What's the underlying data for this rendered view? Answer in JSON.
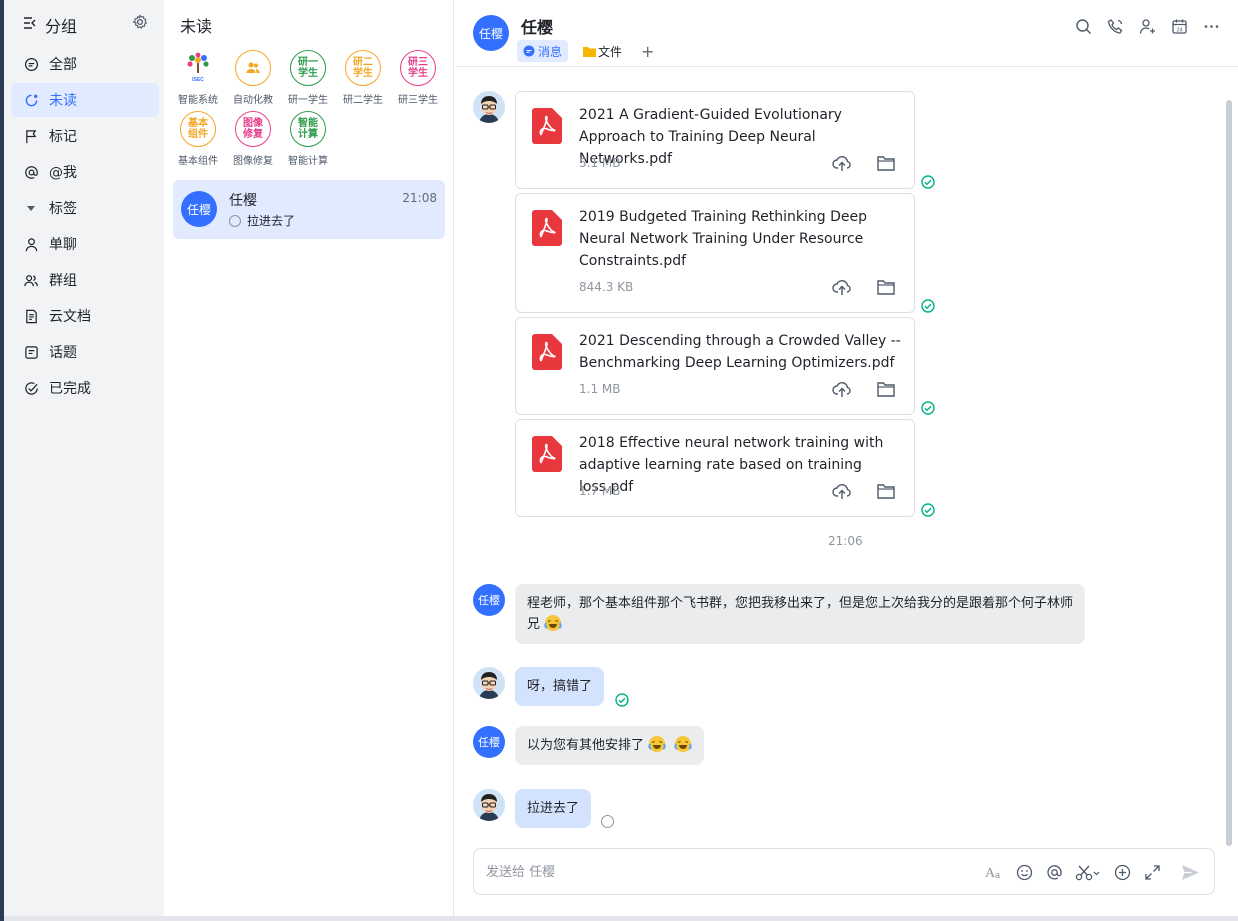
{
  "sidebar": {
    "title": "分组",
    "items": [
      {
        "label": "全部",
        "icon": "chat-bubble-icon"
      },
      {
        "label": "未读",
        "icon": "unread-icon",
        "active": true
      },
      {
        "label": "标记",
        "icon": "flag-icon"
      },
      {
        "label": "@我",
        "icon": "at-icon"
      },
      {
        "label": "标签",
        "icon": "caret-down-icon"
      },
      {
        "label": "单聊",
        "icon": "user-icon"
      },
      {
        "label": "群组",
        "icon": "group-icon"
      },
      {
        "label": "云文档",
        "icon": "document-icon"
      },
      {
        "label": "话题",
        "icon": "topic-icon"
      },
      {
        "label": "已完成",
        "icon": "done-icon"
      }
    ]
  },
  "unread": {
    "title": "未读",
    "groups": [
      {
        "badge": "",
        "caption": "智能系统",
        "color": "#2c9b4a"
      },
      {
        "badge": "",
        "caption": "自动化教",
        "color": "#f5a623"
      },
      {
        "badge": "研一\n学生",
        "caption": "研一学生",
        "color": "#2c9b4a"
      },
      {
        "badge": "研二\n学生",
        "caption": "研二学生",
        "color": "#f5a623"
      },
      {
        "badge": "研三\n学生",
        "caption": "研三学生",
        "color": "#e83e8c"
      },
      {
        "badge": "基本\n组件",
        "caption": "基本组件",
        "color": "#f5a623"
      },
      {
        "badge": "图像\n修复",
        "caption": "图像修复",
        "color": "#e83e8c"
      },
      {
        "badge": "智能\n计算",
        "caption": "智能计算",
        "color": "#2c9b4a"
      }
    ],
    "conversation": {
      "avatar": "任樱",
      "name": "任樱",
      "time": "21:08",
      "preview": "拉进去了"
    }
  },
  "chat": {
    "avatar": "任樱",
    "name": "任樱",
    "tabs": {
      "messages": "消息",
      "files": "文件",
      "add": "+"
    },
    "files": [
      {
        "name": "2021 A Gradient-Guided Evolutionary Approach to Training Deep Neural Networks.pdf",
        "size": "5.1 MB"
      },
      {
        "name": "2019 Budgeted Training Rethinking Deep Neural Network Training Under Resource Constraints.pdf",
        "size": "844.3 KB"
      },
      {
        "name": "2021 Descending through a Crowded Valley -- Benchmarking Deep Learning Optimizers.pdf",
        "size": "1.1 MB"
      },
      {
        "name": "2018 Effective neural network training with adaptive learning rate based on training loss.pdf",
        "size": "1.7 MB"
      }
    ],
    "timestamp": "21:06",
    "messages": [
      {
        "from": "other",
        "avatar": "任樱",
        "text": "程老师，那个基本组件那个飞书群，您把我移出来了，但是您上次给我分的是跟着那个何子林师兄"
      },
      {
        "from": "me",
        "text": "呀，搞错了"
      },
      {
        "from": "other",
        "avatar": "任樱",
        "text": "以为您有其他安排了"
      },
      {
        "from": "me",
        "text": "拉进去了"
      }
    ],
    "composer": {
      "placeholder": "发送给 任樱"
    }
  },
  "colors": {
    "accent": "#3370ff",
    "read_check": "#00b386",
    "pdf_red": "#e8383d"
  }
}
